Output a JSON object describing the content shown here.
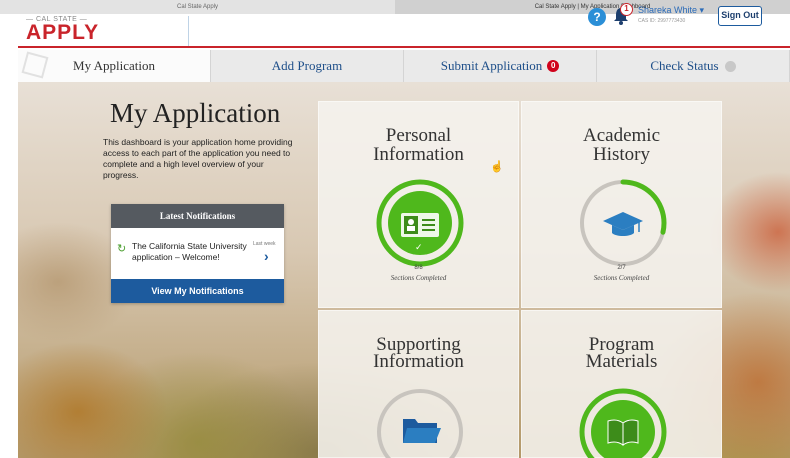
{
  "browser": {
    "tabs": [
      {
        "label": "Cal State Apply",
        "active": false
      },
      {
        "label": "Cal State Apply | My Application Dashboard",
        "active": true
      }
    ]
  },
  "header": {
    "logo_small": "— CAL STATE —",
    "logo_big": "APPLY",
    "help_label": "?",
    "notification_count": "1",
    "user_name": "Shareka White ▾",
    "cas_id": "CAS ID: 2997773430",
    "signout_label": "Sign Out"
  },
  "nav": {
    "tabs": [
      {
        "label": "My Application",
        "active": true
      },
      {
        "label": "Add Program",
        "active": false
      },
      {
        "label": "Submit Application",
        "active": false,
        "badge": "0"
      },
      {
        "label": "Check Status",
        "active": false
      }
    ]
  },
  "intro": {
    "title": "My Application",
    "text": "This dashboard is your application home providing access to each part of the application you need to complete and a high level overview of your progress."
  },
  "notifications": {
    "header": "Latest Notifications",
    "message": "The California State University application – Welcome!",
    "time": "Last week",
    "button": "View My Notifications"
  },
  "cards": [
    {
      "title_1": "Personal",
      "title_2": "Information",
      "completed": 8,
      "total": 8,
      "count_label": "8/8",
      "sub": "Sections Completed",
      "icon": "id-card-icon"
    },
    {
      "title_1": "Academic",
      "title_2": "History",
      "completed": 2,
      "total": 7,
      "count_label": "2/7",
      "sub": "Sections Completed",
      "icon": "graduation-cap-icon"
    },
    {
      "title_1": "Supporting",
      "title_2": "Information",
      "icon": "folder-icon"
    },
    {
      "title_1": "Program",
      "title_2": "Materials",
      "icon": "book-icon"
    }
  ],
  "colors": {
    "brand_red": "#c9242b",
    "primary_blue": "#1d5b9e",
    "progress_green": "#4fb81c",
    "ring_gray": "#c8c4be"
  }
}
